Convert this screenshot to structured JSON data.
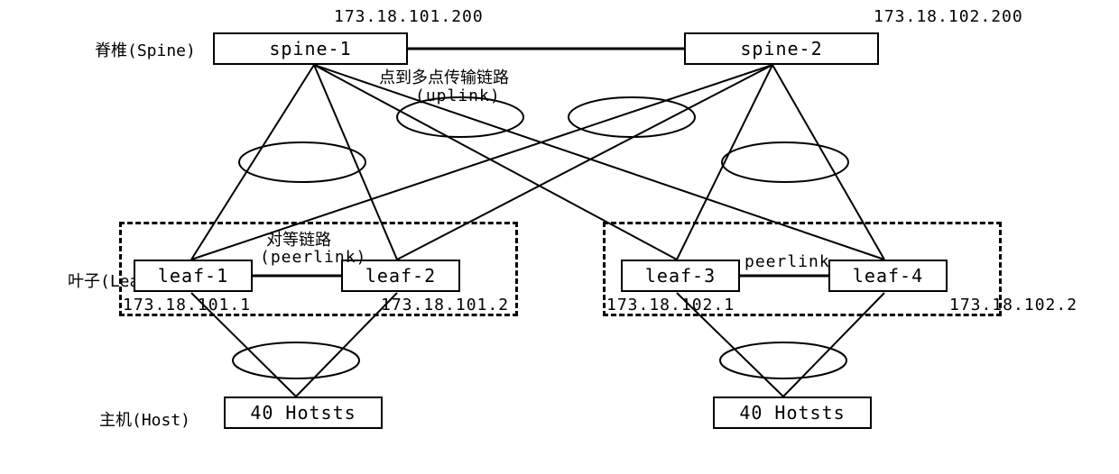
{
  "ips": {
    "spine1": "173.18.101.200",
    "spine2": "173.18.102.200",
    "leaf1": "173.18.101.1",
    "leaf2": "173.18.101.2",
    "leaf3": "173.18.102.1",
    "leaf4": "173.18.102.2"
  },
  "nodes": {
    "spine1": "spine-1",
    "spine2": "spine-2",
    "leaf1": "leaf-1",
    "leaf2": "leaf-2",
    "leaf3": "leaf-3",
    "leaf4": "leaf-4",
    "hosts_left": "40 Hotsts",
    "hosts_right": "40 Hotsts"
  },
  "link_labels": {
    "uplink_cn": "点到多点传输链路",
    "uplink_en": "(uplink)",
    "peerlink_left_cn": "对等链路",
    "peerlink_left_en": "(peerlink)",
    "peerlink_right": "peerlink"
  },
  "row_labels": {
    "spine": "脊椎(Spine)",
    "leaf": "叶子(Leaf)",
    "host": "主机(Host)"
  }
}
